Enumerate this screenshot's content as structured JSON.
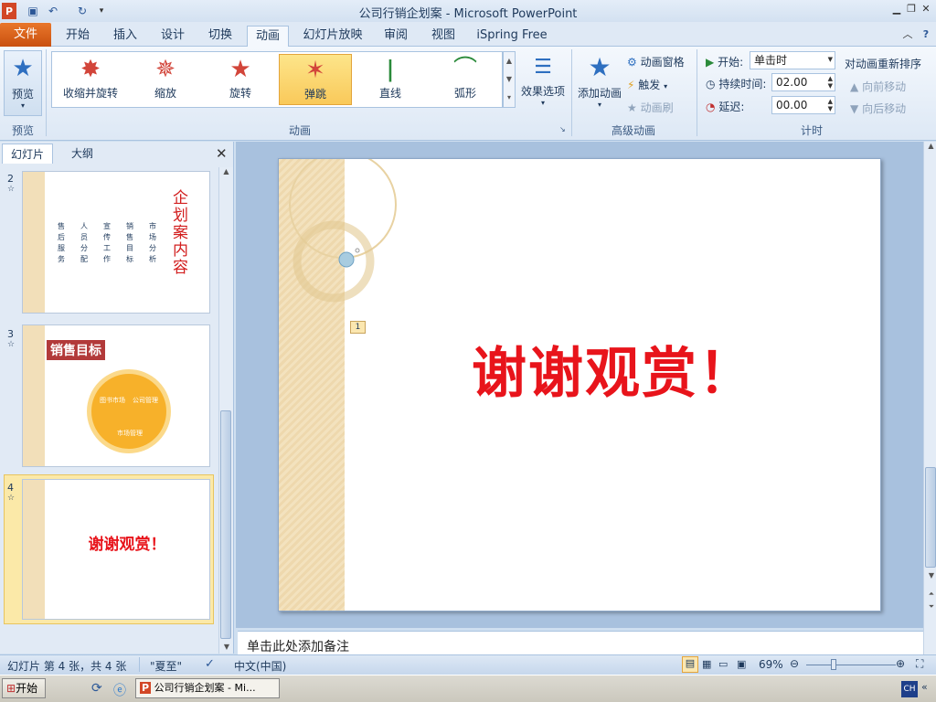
{
  "window": {
    "title": "公司行销企划案 - Microsoft PowerPoint"
  },
  "tabs": [
    {
      "label": "文件"
    },
    {
      "label": "开始"
    },
    {
      "label": "插入"
    },
    {
      "label": "设计"
    },
    {
      "label": "切换"
    },
    {
      "label": "动画"
    },
    {
      "label": "幻灯片放映"
    },
    {
      "label": "审阅"
    },
    {
      "label": "视图"
    },
    {
      "label": "iSpring Free"
    }
  ],
  "ribbon": {
    "preview_label": "预览",
    "preview_group": "预览",
    "animations": [
      {
        "label": "收缩并旋转"
      },
      {
        "label": "缩放"
      },
      {
        "label": "旋转"
      },
      {
        "label": "弹跳"
      },
      {
        "label": "直线"
      },
      {
        "label": "弧形"
      }
    ],
    "effect_options": "效果选项",
    "animation_group": "动画",
    "add_animation": "添加动画",
    "animation_pane": "动画窗格",
    "trigger": "触发",
    "animation_painter": "动画刷",
    "advanced_group": "高级动画",
    "start_label": "开始:",
    "start_value": "单击时",
    "duration_label": "持续时间:",
    "duration_value": "02.00",
    "delay_label": "延迟:",
    "delay_value": "00.00",
    "timing_group": "计时",
    "reorder_title": "对动画重新排序",
    "move_earlier": "向前移动",
    "move_later": "向后移动"
  },
  "left_pane": {
    "tab_slides": "幻灯片",
    "tab_outline": "大纲",
    "slides": [
      {
        "number": "2",
        "title": "企划案内容",
        "columns": [
          "售后服务",
          "人员分配",
          "宣传工作",
          "销售目标",
          "市场分析"
        ]
      },
      {
        "number": "3",
        "title": "销售目标",
        "segments": [
          "图书市场",
          "公司管理",
          "市场管理"
        ]
      },
      {
        "number": "4",
        "title": "谢谢观赏！"
      }
    ]
  },
  "slide": {
    "title": "谢谢观赏！",
    "anim_tag": "1"
  },
  "notes": {
    "placeholder": "单击此处添加备注"
  },
  "status": {
    "slide_info": "幻灯片 第 4 张，共 4 张",
    "theme": "\"夏至\"",
    "language": "中文(中国)",
    "zoom": "69%"
  },
  "taskbar": {
    "start": "开始",
    "app_item": "公司行销企划案 - Mi...",
    "ime": "CH"
  },
  "colors": {
    "accent_orange": "#e3701a",
    "slide_red": "#e8141b",
    "chart_yellow": "#f7b12a"
  }
}
